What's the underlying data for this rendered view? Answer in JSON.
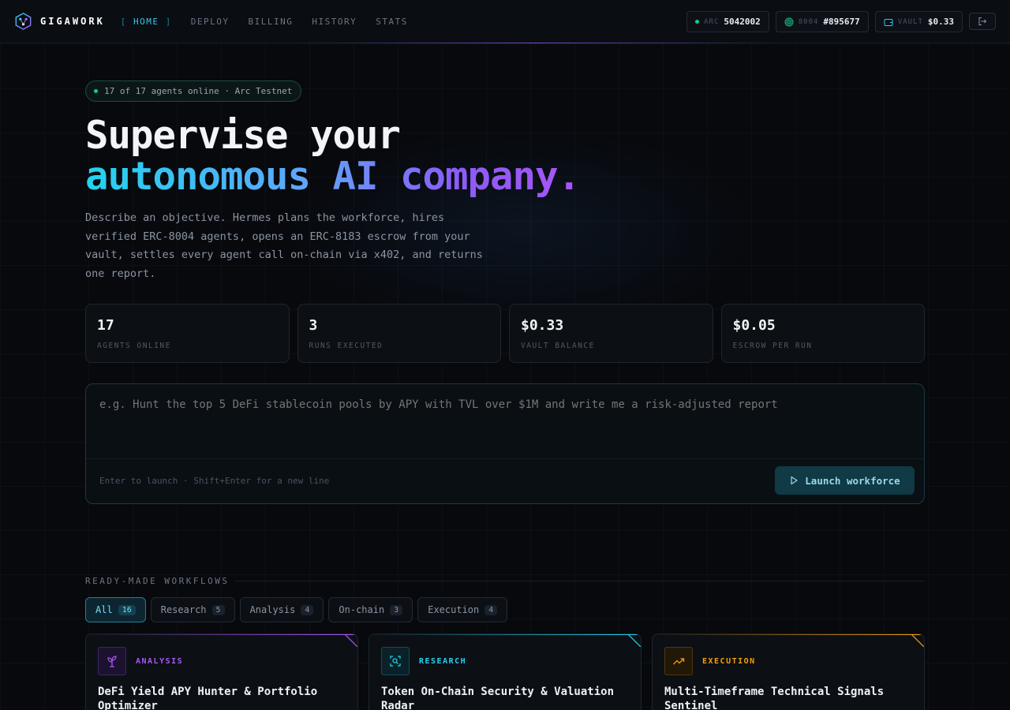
{
  "brand": {
    "name": "GIGAWORK"
  },
  "nav": {
    "items": [
      {
        "label": "HOME",
        "active": true
      },
      {
        "label": "DEPLOY",
        "active": false
      },
      {
        "label": "BILLING",
        "active": false
      },
      {
        "label": "HISTORY",
        "active": false
      },
      {
        "label": "STATS",
        "active": false
      }
    ]
  },
  "header_pills": {
    "arc": {
      "label": "ARC",
      "value": "5042002"
    },
    "erc": {
      "label": "8004",
      "value": "#895677"
    },
    "vault": {
      "label": "VAULT",
      "value": "$0.33"
    }
  },
  "hero": {
    "status": "17 of 17 agents online · Arc Testnet",
    "headline_line1": "Supervise your",
    "headline_line2": "autonomous AI company.",
    "description": "Describe an objective. Hermes plans the workforce, hires verified ERC-8004 agents, opens an ERC-8183 escrow from your vault, settles every agent call on-chain via x402, and returns one report."
  },
  "stats": [
    {
      "value": "17",
      "label": "AGENTS ONLINE"
    },
    {
      "value": "3",
      "label": "RUNS EXECUTED"
    },
    {
      "value": "$0.33",
      "label": "VAULT BALANCE"
    },
    {
      "value": "$0.05",
      "label": "ESCROW PER RUN"
    }
  ],
  "composer": {
    "placeholder": "e.g. Hunt the top 5 DeFi stablecoin pools by APY with TVL over $1M and write me a risk-adjusted report",
    "value": "",
    "hint": "Enter to launch · Shift+Enter for a new line",
    "launch_label": "Launch workforce"
  },
  "workflows": {
    "section_title": "READY-MADE WORKFLOWS",
    "filters": [
      {
        "label": "All",
        "count": "16",
        "active": true
      },
      {
        "label": "Research",
        "count": "5",
        "active": false
      },
      {
        "label": "Analysis",
        "count": "4",
        "active": false
      },
      {
        "label": "On-chain",
        "count": "3",
        "active": false
      },
      {
        "label": "Execution",
        "count": "4",
        "active": false
      }
    ],
    "cards": [
      {
        "category": "ANALYSIS",
        "title": "DeFi Yield APY Hunter & Portfolio Optimizer",
        "icon": "sprout-icon",
        "color": "#a855f7"
      },
      {
        "category": "RESEARCH",
        "title": "Token On-Chain Security & Valuation Radar",
        "icon": "scan-search-icon",
        "color": "#22d3ee"
      },
      {
        "category": "EXECUTION",
        "title": "Multi-Timeframe Technical Signals Sentinel",
        "icon": "trending-up-icon",
        "color": "#f59e0b"
      }
    ]
  },
  "colors": {
    "accent_cyan": "#35c6e6",
    "accent_purple": "#a855f7",
    "accent_amber": "#f59e0b",
    "online_green": "#18c98f"
  }
}
